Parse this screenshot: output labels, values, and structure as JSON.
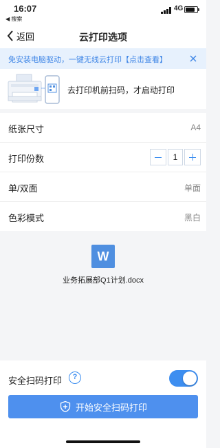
{
  "status_bar": {
    "time": "16:07",
    "back_app": "◀ 搜索",
    "network": "4G",
    "battery_level": 0.8
  },
  "nav": {
    "back_label": "返回",
    "title": "云打印选项"
  },
  "banner": {
    "text": "免安装电脑驱动，一键无线云打印【点击查看】",
    "accent_color": "#3f86e6"
  },
  "hero": {
    "text": "去打印机前扫码，才启动打印"
  },
  "settings": {
    "paper_size": {
      "label": "纸张尺寸",
      "value": "A4"
    },
    "copies": {
      "label": "打印份数",
      "value": "1"
    },
    "duplex": {
      "label": "单/双面",
      "value": "单面"
    },
    "color_mode": {
      "label": "色彩模式",
      "value": "黑白"
    }
  },
  "file": {
    "icon_letter": "W",
    "name": "业务拓展部Q1计划.docx"
  },
  "secure_print": {
    "label": "安全扫码打印",
    "help_glyph": "?",
    "enabled": true,
    "start_button_label": "开始安全扫码打印"
  },
  "colors": {
    "primary": "#3d8ef0",
    "button": "#4e90ee",
    "page_bg": "#f4f5f7"
  }
}
